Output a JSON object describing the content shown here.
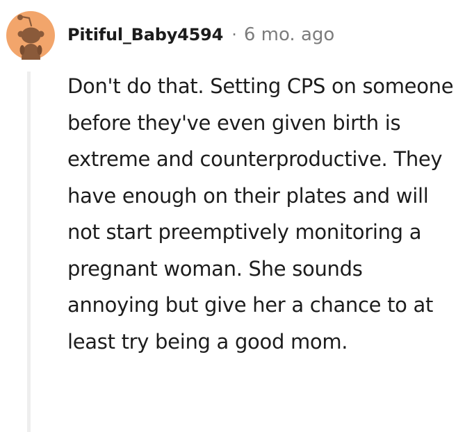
{
  "comment": {
    "username": "Pitiful_Baby4594",
    "separator": "·",
    "timestamp": "6 mo. ago",
    "avatar_icon": "snoo-avatar-icon",
    "body": "Don't do that. Setting CPS on someone before they've even given birth is extreme and counterproductive. They have enough on their plates and will not start preemptively monitoring a pregnant woman. She sounds annoying but give her a chance to at least try being a good mom."
  },
  "colors": {
    "avatar_bg": "#f2a56b",
    "avatar_figure": "#8a5a3a",
    "username": "#1c1c1c",
    "meta": "#7c7c7c",
    "body_text": "#1c1c1c",
    "thread_line": "#eeeeee"
  }
}
